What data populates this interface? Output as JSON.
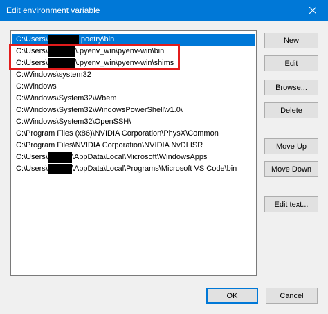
{
  "window": {
    "title": "Edit environment variable",
    "close_glyph": "✕"
  },
  "list": {
    "items": [
      {
        "parts": [
          {
            "t": "text",
            "v": "C:\\Users\\"
          },
          {
            "t": "redact",
            "w": 45
          },
          {
            "t": "text",
            "v": ".poetry\\bin"
          }
        ],
        "selected": true
      },
      {
        "parts": [
          {
            "t": "text",
            "v": "C:\\Users\\"
          },
          {
            "t": "redact",
            "w": 40
          },
          {
            "t": "text",
            "v": "\\.pyenv_win\\pyenv-win\\bin"
          }
        ],
        "selected": false
      },
      {
        "parts": [
          {
            "t": "text",
            "v": "C:\\Users\\"
          },
          {
            "t": "redact",
            "w": 40
          },
          {
            "t": "text",
            "v": "\\.pyenv_win\\pyenv-win\\shims"
          }
        ],
        "selected": false
      },
      {
        "parts": [
          {
            "t": "text",
            "v": "C:\\Windows\\system32"
          }
        ],
        "selected": false
      },
      {
        "parts": [
          {
            "t": "text",
            "v": "C:\\Windows"
          }
        ],
        "selected": false
      },
      {
        "parts": [
          {
            "t": "text",
            "v": "C:\\Windows\\System32\\Wbem"
          }
        ],
        "selected": false
      },
      {
        "parts": [
          {
            "t": "text",
            "v": "C:\\Windows\\System32\\WindowsPowerShell\\v1.0\\"
          }
        ],
        "selected": false
      },
      {
        "parts": [
          {
            "t": "text",
            "v": "C:\\Windows\\System32\\OpenSSH\\"
          }
        ],
        "selected": false
      },
      {
        "parts": [
          {
            "t": "text",
            "v": "C:\\Program Files (x86)\\NVIDIA Corporation\\PhysX\\Common"
          }
        ],
        "selected": false
      },
      {
        "parts": [
          {
            "t": "text",
            "v": "C:\\Program Files\\NVIDIA Corporation\\NVIDIA NvDLISR"
          }
        ],
        "selected": false
      },
      {
        "parts": [
          {
            "t": "text",
            "v": "C:\\Users\\"
          },
          {
            "t": "redact",
            "w": 35
          },
          {
            "t": "text",
            "v": "\\AppData\\Local\\Microsoft\\WindowsApps"
          }
        ],
        "selected": false
      },
      {
        "parts": [
          {
            "t": "text",
            "v": "C:\\Users\\"
          },
          {
            "t": "redact",
            "w": 35
          },
          {
            "t": "text",
            "v": "\\AppData\\Local\\Programs\\Microsoft VS Code\\bin"
          }
        ],
        "selected": false
      }
    ]
  },
  "buttons": {
    "new": "New",
    "edit": "Edit",
    "browse": "Browse...",
    "delete": "Delete",
    "move_up": "Move Up",
    "move_down": "Move Down",
    "edit_text": "Edit text...",
    "ok": "OK",
    "cancel": "Cancel"
  },
  "colors": {
    "titlebar": "#0078d7",
    "selection": "#0078d7",
    "annotation": "#e21c1c"
  }
}
